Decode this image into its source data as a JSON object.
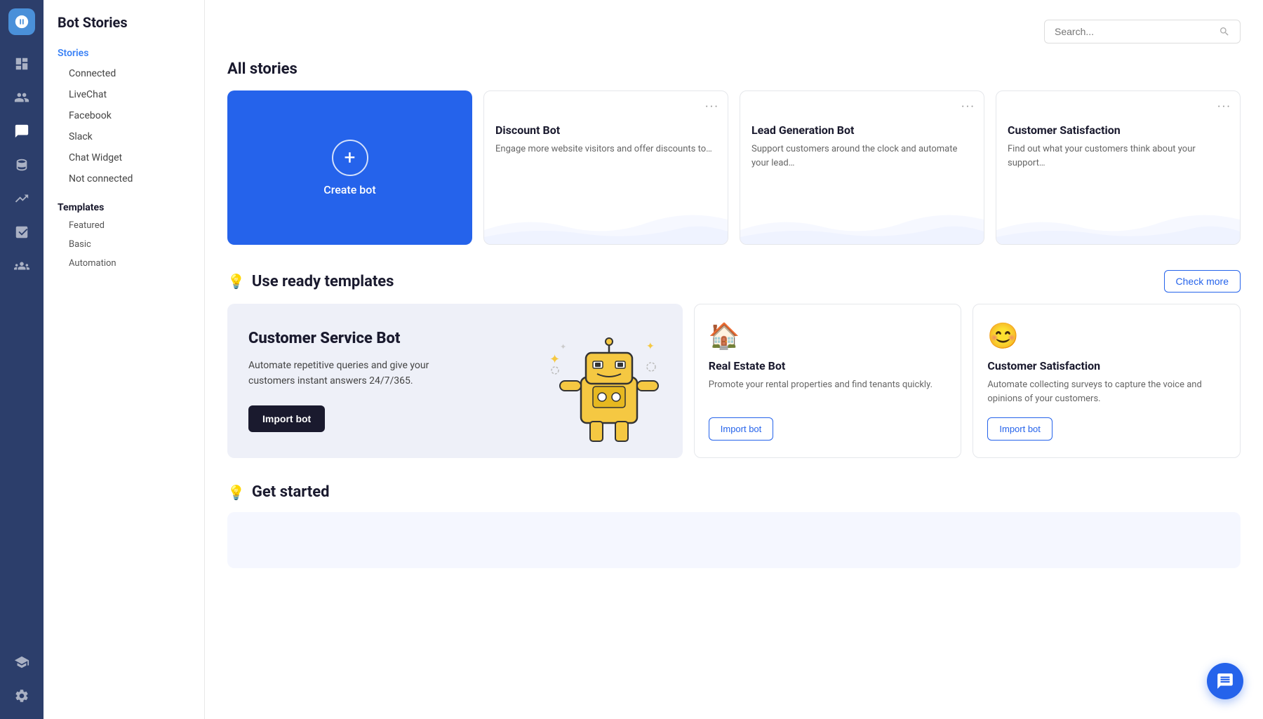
{
  "page": {
    "title": "Bot Stories"
  },
  "icon_nav": {
    "items": [
      {
        "name": "dashboard-icon",
        "label": "Dashboard"
      },
      {
        "name": "users-icon",
        "label": "Users"
      },
      {
        "name": "chat-icon",
        "label": "Chat"
      },
      {
        "name": "database-icon",
        "label": "Database"
      },
      {
        "name": "analytics-icon",
        "label": "Analytics"
      },
      {
        "name": "reports-icon",
        "label": "Reports"
      },
      {
        "name": "team-icon",
        "label": "Team"
      },
      {
        "name": "academy-icon",
        "label": "Academy"
      },
      {
        "name": "settings-icon",
        "label": "Settings"
      }
    ]
  },
  "sidebar": {
    "section_label": "Stories",
    "connected_label": "Connected",
    "connected_items": [
      "LiveChat",
      "Facebook",
      "Slack",
      "Chat Widget"
    ],
    "not_connected_label": "Not connected",
    "templates_label": "Templates",
    "templates_items": [
      "Featured",
      "Basic",
      "Automation"
    ]
  },
  "header": {
    "search_placeholder": "Search..."
  },
  "all_stories": {
    "title": "All stories",
    "create_bot": {
      "label": "Create bot"
    },
    "bot_cards": [
      {
        "title": "Discount Bot",
        "description": "Engage more website visitors and offer discounts to…"
      },
      {
        "title": "Lead Generation Bot",
        "description": "Support customers around the clock and automate your lead…"
      },
      {
        "title": "Customer Satisfaction",
        "description": "Find out what your customers think about your support…"
      }
    ]
  },
  "templates": {
    "section_title": "Use ready templates",
    "check_more_label": "Check more",
    "featured": {
      "title": "Customer Service Bot",
      "description": "Automate repetitive queries and give your customers instant answers 24/7/365.",
      "import_label": "Import bot"
    },
    "cards": [
      {
        "icon": "🏠",
        "title": "Real Estate Bot",
        "description": "Promote your rental properties and find tenants quickly.",
        "import_label": "Import bot"
      },
      {
        "icon": "😊",
        "title": "Customer Satisfaction",
        "description": "Automate collecting surveys to capture the voice and opinions of your customers.",
        "import_label": "Import bot"
      }
    ]
  },
  "get_started": {
    "title": "Get started"
  },
  "fab": {
    "label": "Chat support"
  }
}
